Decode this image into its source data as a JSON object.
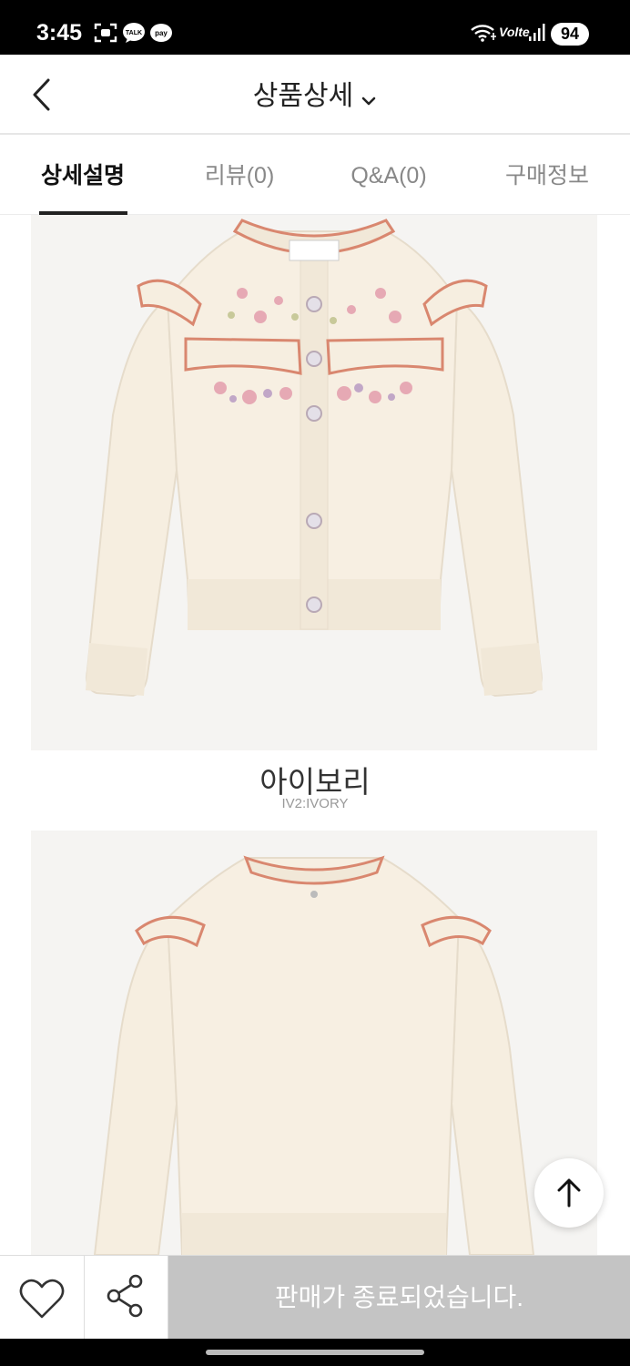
{
  "status_bar": {
    "time": "3:45",
    "network": "Volte",
    "battery": "94",
    "icons": [
      "screenshot-icon",
      "talk-icon",
      "pay-icon",
      "wifi-icon",
      "signal-icon"
    ]
  },
  "header": {
    "title": "상품상세",
    "back_icon": "chevron-left-icon",
    "dropdown_icon": "chevron-down-icon"
  },
  "tabs": [
    {
      "label": "상세설명",
      "active": true
    },
    {
      "label": "리뷰(0)",
      "active": false
    },
    {
      "label": "Q&A(0)",
      "active": false
    },
    {
      "label": "구매정보",
      "active": false
    }
  ],
  "product": {
    "color_name": "아이보리",
    "color_code": "IV2:IVORY"
  },
  "bottom_bar": {
    "wishlist_icon": "heart-icon",
    "share_icon": "share-icon",
    "status_label": "판매가 종료되었습니다."
  },
  "colors": {
    "sweater": "#f6eee0",
    "trim": "#d9876f",
    "soldout_bg": "#c4c4c4"
  }
}
